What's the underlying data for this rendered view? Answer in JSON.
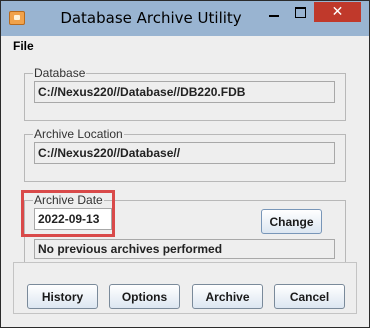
{
  "window": {
    "title": "Database Archive Utility"
  },
  "titlebar_buttons": {
    "minimize": "minimize-icon",
    "maximize": "maximize-icon",
    "close_glyph": "✕"
  },
  "menu": {
    "file": "File"
  },
  "database": {
    "legend": "Database",
    "path": "C://Nexus220//Database//DB220.FDB"
  },
  "archive_location": {
    "legend": "Archive Location",
    "path": "C://Nexus220//Database//"
  },
  "archive_date": {
    "legend": "Archive Date",
    "value": "2022-09-13",
    "change_label": "Change",
    "status": "No previous archives performed"
  },
  "buttons": {
    "history": "History",
    "options": "Options",
    "archive": "Archive",
    "cancel": "Cancel"
  },
  "colors": {
    "titlebar": "#99b4d1",
    "close_button": "#c0392b",
    "highlight": "#d94a4a",
    "window_bg": "#eeeeee"
  }
}
